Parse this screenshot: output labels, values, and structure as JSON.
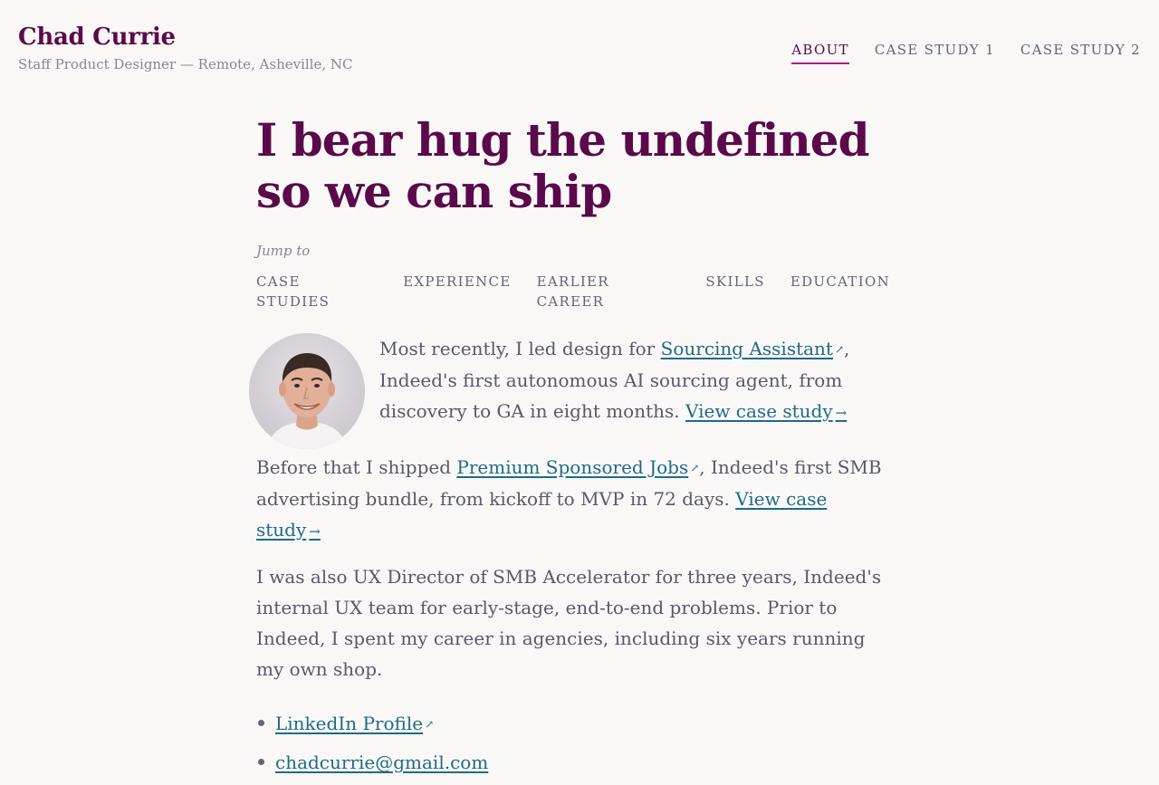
{
  "header": {
    "site_name": "Chad Currie",
    "tagline": "Staff Product Designer — Remote, Asheville, NC"
  },
  "nav": {
    "items": [
      {
        "label": "ABOUT",
        "active": true
      },
      {
        "label": "CASE STUDY 1",
        "active": false
      },
      {
        "label": "CASE STUDY 2",
        "active": false
      }
    ]
  },
  "hero": {
    "title": "I bear hug the undefined so we can ship"
  },
  "jump": {
    "label": "Jump to",
    "links": [
      "CASE STUDIES",
      "EXPERIENCE",
      "EARLIER CAREER",
      "SKILLS",
      "EDUCATION"
    ]
  },
  "intro": {
    "p1": {
      "before": "Most recently, I led design for ",
      "link": "Sourcing Assistant",
      "after": ", Indeed's first autonomous AI sourcing agent, from discovery to GA in eight months. ",
      "cta": "View case study"
    },
    "p2": {
      "before": "Before that I shipped ",
      "link": "Premium Sponsored Jobs",
      "after": ", Indeed's first SMB advertising bundle, from kickoff to MVP in 72 days. ",
      "cta": "View case study"
    },
    "p3": "I was also UX Director of SMB Accelerator for three years, Indeed's internal UX team for early-stage, end-to-end problems. Prior to Indeed, I spent my career in agencies, including six years running my own shop."
  },
  "contact": {
    "linkedin": "LinkedIn Profile",
    "email": "chadcurrie@gmail.com"
  },
  "icons": {
    "external": "external-link-icon",
    "arrow": "arrow-right-icon"
  },
  "colors": {
    "brand": "#5a0a4a",
    "accent_underline": "#b01a8a",
    "link": "#1e6b86",
    "body_text": "#5f5568",
    "background": "#faf8f7"
  }
}
